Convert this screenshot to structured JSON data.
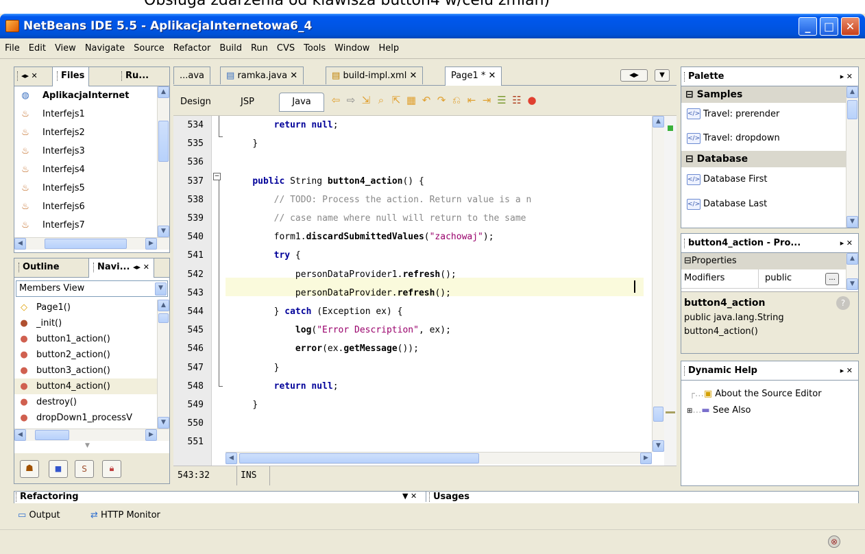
{
  "top_cut_text": "Obsługa zdarzenia od klawisza button4 w/celu zmian)",
  "window": {
    "title": "NetBeans IDE 5.5 - AplikacjaInternetowa6_4"
  },
  "menu": [
    "File",
    "Edit",
    "View",
    "Navigate",
    "Source",
    "Refactor",
    "Build",
    "Run",
    "CVS",
    "Tools",
    "Window",
    "Help"
  ],
  "files_panel": {
    "tabs": [
      "Files",
      "Ru..."
    ],
    "items": [
      "AplikacjaInternet",
      "Interfejs1",
      "Interfejs2",
      "Interfejs3",
      "Interfejs4",
      "Interfejs5",
      "Interfejs6",
      "Interfejs7"
    ]
  },
  "navigator_panel": {
    "tabs": [
      "Outline",
      "Navi..."
    ],
    "view_select": "Members View",
    "items": [
      "Page1()",
      "_init()",
      "button1_action()",
      "button2_action()",
      "button3_action()",
      "button4_action()",
      "destroy()",
      "dropDown1_processV"
    ]
  },
  "editor": {
    "tabs": [
      "...ava",
      "ramka.java",
      "build-impl.xml",
      "Page1 *"
    ],
    "view_tabs": [
      "Design",
      "JSP",
      "Java"
    ],
    "lines": [
      {
        "n": "534",
        "t": "return_null"
      },
      {
        "n": "535",
        "t": "close"
      },
      {
        "n": "536",
        "t": "empty"
      },
      {
        "n": "537",
        "t": "sig"
      },
      {
        "n": "538",
        "t": "c1"
      },
      {
        "n": "539",
        "t": "c2"
      },
      {
        "n": "540",
        "t": "discard"
      },
      {
        "n": "541",
        "t": "try"
      },
      {
        "n": "542",
        "t": "r1"
      },
      {
        "n": "543",
        "t": "r2"
      },
      {
        "n": "544",
        "t": "catch"
      },
      {
        "n": "545",
        "t": "log"
      },
      {
        "n": "546",
        "t": "err"
      },
      {
        "n": "547",
        "t": "close2"
      },
      {
        "n": "548",
        "t": "return_null2"
      },
      {
        "n": "549",
        "t": "close"
      },
      {
        "n": "550",
        "t": "empty"
      },
      {
        "n": "551",
        "t": "empty"
      }
    ],
    "code": {
      "return": "return",
      "null": "null",
      "public": "public",
      "String": "String",
      "button4_action": "button4_action",
      "sig_rest": "() {",
      "comment1": "// TODO: Process the action. Return value is a n",
      "comment2": "// case name where null will return to the same",
      "form1": "form1.",
      "discard": "discardSubmittedValues",
      "zachowaj": "\"zachowaj\"",
      "discard_end": ");",
      "try": "try",
      "open": " {",
      "pdp1": "personDataProvider1.",
      "refresh": "refresh",
      "call_end": "();",
      "pdp": "personDataProvider.",
      "catch_pre": "} ",
      "catch": "catch",
      "catch_rest": " (Exception ex) {",
      "log": "log",
      "err_desc": "\"Error Description\"",
      "log_rest": ", ex);",
      "error": "error",
      "ex_dot": "(ex.",
      "getMessage": "getMessage",
      "err_rest": "());",
      "brace": "}"
    },
    "status": {
      "pos": "543:32",
      "mode": "INS"
    }
  },
  "palette": {
    "title": "Palette",
    "sections": [
      {
        "name": "Samples",
        "items": [
          "Travel: prerender",
          "Travel: dropdown"
        ]
      },
      {
        "name": "Database",
        "items": [
          "Database First",
          "Database Last"
        ]
      }
    ]
  },
  "properties": {
    "title": "button4_action - Pro...",
    "section": "Properties",
    "row": {
      "key": "Modifiers",
      "value": "public"
    },
    "desc_title": "button4_action",
    "desc": [
      "public java.lang.String",
      "button4_action()"
    ]
  },
  "dynamic_help": {
    "title": "Dynamic Help",
    "items": [
      "About the Source Editor",
      "See Also"
    ]
  },
  "bottom": {
    "tabs": [
      "Refactoring",
      "Usages"
    ],
    "buttons": [
      "Output",
      "HTTP Monitor"
    ]
  }
}
